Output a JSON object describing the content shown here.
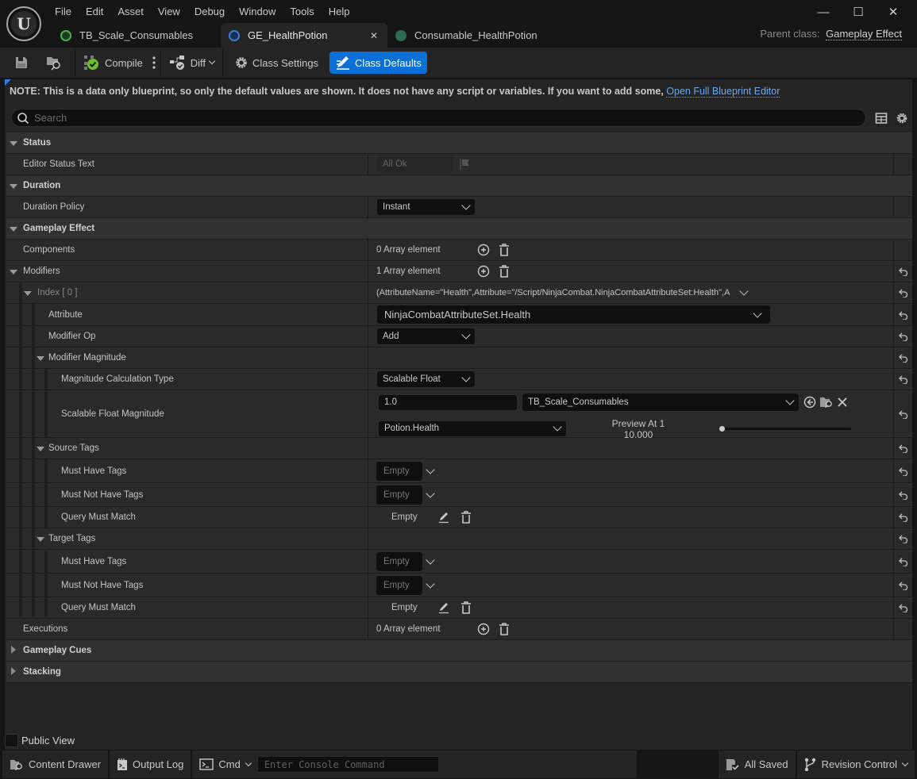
{
  "app": {
    "logo": "unreal-engine-logo",
    "menu": [
      "File",
      "Edit",
      "Asset",
      "View",
      "Debug",
      "Window",
      "Tools",
      "Help"
    ],
    "window_controls": {
      "minimize": "—",
      "maximize": "☐",
      "close": "✕"
    }
  },
  "tabs": [
    {
      "label": "TB_Scale_Consumables",
      "icon": "curve-table-icon",
      "icon_color": "#4caf50",
      "active": false
    },
    {
      "label": "GE_HealthPotion",
      "icon": "blueprint-icon",
      "icon_color": "#3a7bd5",
      "active": true,
      "close": "✕"
    },
    {
      "label": "Consumable_HealthPotion",
      "icon": "data-asset-icon",
      "icon_color": "#2f6b4f",
      "active": false
    }
  ],
  "parent_class": {
    "label": "Parent class:",
    "value": "Gameplay Effect"
  },
  "toolbar": {
    "save": "save-icon",
    "browse": "browse-icon",
    "compile_label": "Compile",
    "diff_label": "Diff",
    "class_settings_label": "Class Settings",
    "class_defaults_label": "Class Defaults",
    "accent": "#0a70d8"
  },
  "note": {
    "text": "NOTE: This is a data only blueprint, so only the default values are shown.  It does not have any script or variables.  If you want to add some,",
    "link": "Open Full Blueprint Editor"
  },
  "search": {
    "placeholder": "Search",
    "value": ""
  },
  "details": {
    "status": {
      "header": "Status",
      "editor_status_text": {
        "label": "Editor Status Text",
        "value": "All Ok"
      }
    },
    "duration": {
      "header": "Duration",
      "duration_policy": {
        "label": "Duration Policy",
        "value": "Instant"
      }
    },
    "gameplay_effect": {
      "header": "Gameplay Effect",
      "components": {
        "label": "Components",
        "value": "0 Array element"
      },
      "modifiers": {
        "label": "Modifiers",
        "value": "1 Array element",
        "index0": {
          "label": "Index [ 0 ]",
          "summary": "(AttributeName=\"Health\",Attribute=\"/Script/NinjaCombat.NinjaCombatAttributeSet:Health\",A",
          "attribute": {
            "label": "Attribute",
            "value": "NinjaCombatAttributeSet.Health"
          },
          "modifier_op": {
            "label": "Modifier Op",
            "value": "Add"
          },
          "modifier_magnitude": {
            "label": "Modifier Magnitude",
            "calc_type": {
              "label": "Magnitude Calculation Type",
              "value": "Scalable Float"
            },
            "scalable_float": {
              "label": "Scalable Float Magnitude",
              "value": "1.0",
              "curve_table": "TB_Scale_Consumables",
              "row_name": "Potion.Health",
              "preview_label": "Preview At 1",
              "preview_value": "10.000",
              "preview_slider": 0.0
            }
          },
          "source_tags": {
            "label": "Source Tags",
            "must_have": {
              "label": "Must Have Tags",
              "value": "Empty"
            },
            "must_not_have": {
              "label": "Must Not Have Tags",
              "value": "Empty"
            },
            "query": {
              "label": "Query Must Match",
              "value": "Empty"
            }
          },
          "target_tags": {
            "label": "Target Tags",
            "must_have": {
              "label": "Must Have Tags",
              "value": "Empty"
            },
            "must_not_have": {
              "label": "Must Not Have Tags",
              "value": "Empty"
            },
            "query": {
              "label": "Query Must Match",
              "value": "Empty"
            }
          }
        }
      },
      "executions": {
        "label": "Executions",
        "value": "0 Array element"
      }
    },
    "gameplay_cues": {
      "header": "Gameplay Cues"
    },
    "stacking": {
      "header": "Stacking"
    }
  },
  "public_view": {
    "label": "Public View",
    "checked": false
  },
  "statusbar": {
    "content_drawer": "Content Drawer",
    "output_log": "Output Log",
    "cmd": "Cmd",
    "console_placeholder": "Enter Console Command",
    "all_saved": "All Saved",
    "revision_control": "Revision Control"
  }
}
